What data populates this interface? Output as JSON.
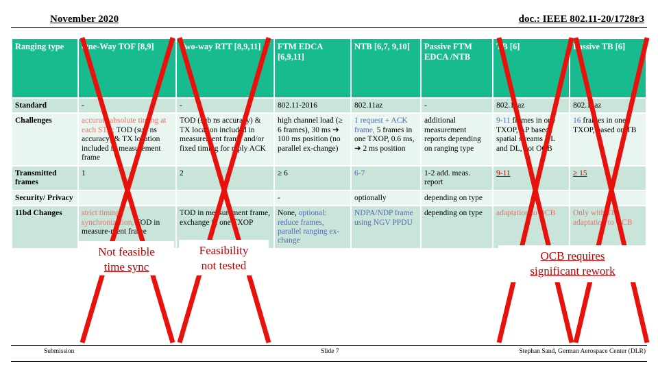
{
  "header": {
    "left": "November 2020",
    "right": "doc.: IEEE 802.11-20/1728r3"
  },
  "table": {
    "columns": [
      "Ranging type",
      "One-Way TOF [8,9]",
      "Two-way RTT [8,9,11]",
      "FTM EDCA [6,9,11]",
      "NTB [6,7, 9,10]",
      "Passive FTM EDCA /NTB",
      "TB [6]",
      "Passive TB [6]"
    ],
    "rows": [
      {
        "label": "Standard",
        "cells": [
          {
            "text": "-"
          },
          {
            "text": "-"
          },
          {
            "text": "802.11-2016"
          },
          {
            "text": "802.11az"
          },
          {
            "text": "-"
          },
          {
            "text": "802.11az"
          },
          {
            "text": "802.11az"
          }
        ]
      },
      {
        "label": "Challenges",
        "cells": [
          {
            "red": "accurate absolute timing at each STA;",
            "text": " TOD (sub ns accuracy) & TX location included in measurement frame"
          },
          {
            "text": "TOD (sub ns accuracy) & TX location included in measurement frame and/or fixed timing for reply ACK"
          },
          {
            "text": "high channel load (≥ 6 frames), 30 ms ➔ 100 ms position (no parallel ex-change)"
          },
          {
            "blue": "1 request + ACK frame,",
            "text": " 5 frames in one TXOP, 0.6 ms, ➔ 2 ms position"
          },
          {
            "text": "additional measurement reports depending on ranging type"
          },
          {
            "blue": "9-11",
            "text": " frames in one TXOP, AP based, spatial streams UL and DL, not OCB"
          },
          {
            "blue": "16",
            "text": " frames in one TXOP, based on TB"
          }
        ]
      },
      {
        "label": "Transmitted frames",
        "cells": [
          {
            "text": "1"
          },
          {
            "text": "2"
          },
          {
            "text": "≥ 6"
          },
          {
            "blue": "6-7"
          },
          {
            "text": "1-2  add. meas. report"
          },
          {
            "dkred_u": "9-11"
          },
          {
            "dkred_u": "≥ 15"
          }
        ]
      },
      {
        "label": "Security/ Privacy",
        "cells": [
          {
            "text": ""
          },
          {
            "text": ""
          },
          {
            "text": "-"
          },
          {
            "text": "optionally"
          },
          {
            "text": "depending on type"
          },
          {
            "text": ""
          },
          {
            "text": ""
          }
        ]
      },
      {
        "label": "11bd Changes",
        "cells": [
          {
            "red": "strict timing synchronization,",
            "text": " TOD in measure-ment frame"
          },
          {
            "text": "TOD in measurement frame, exchange in one TXOP"
          },
          {
            "text": "None, ",
            "blue_after": "optional: reduce frames, parallel ranging ex-change"
          },
          {
            "blue": "NDPA/NDP frame using NGV PPDU"
          },
          {
            "text": "depending on type"
          },
          {
            "red": "adaptation to OCB"
          },
          {
            "red": "Only with TB, adaptation to OCB"
          }
        ]
      }
    ]
  },
  "callouts": [
    {
      "name": "not-feasible-time-sync",
      "line1": "Not feasible",
      "line2": "time sync"
    },
    {
      "name": "feasibility-not-tested",
      "line1": "Feasibility",
      "line2": "not tested"
    },
    {
      "name": "ocb-requires-rework",
      "line1": "OCB requires",
      "line2": "significant rework"
    }
  ],
  "footer": {
    "left": "Submission",
    "middle": "Slide 7",
    "right": "Stephan Sand, German Aerospace Center (DLR)"
  },
  "colors": {
    "header_green": "#17bb8e",
    "cell_green": "#dceee3",
    "strike_red": "#e8110c",
    "callout_red": "#c00000",
    "blue_text": "#5566b5",
    "light_red_text": "#e8726a"
  }
}
